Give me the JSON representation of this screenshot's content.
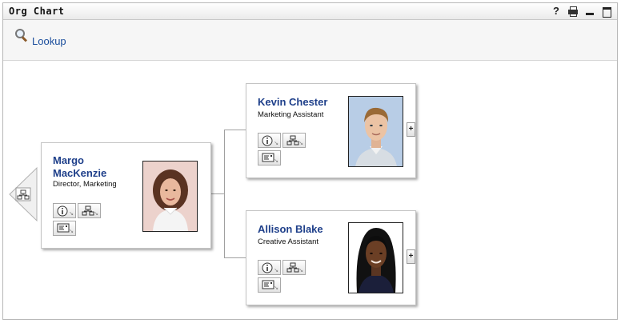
{
  "window": {
    "title": "Org Chart",
    "help_glyph": "?",
    "icons": [
      "help-icon",
      "print-icon",
      "minimize-icon",
      "maximize-icon"
    ]
  },
  "toolbar": {
    "lookup_label": "Lookup",
    "lookup_icon": "search-icon"
  },
  "colors": {
    "name_text": "#1e3f8a",
    "link_text": "#1a4d9c",
    "connector": "#a0a0a0"
  },
  "org": {
    "up_nav_icon": "org-chart-icon",
    "manager": {
      "first_name": "Margo",
      "last_name": "MacKenzie",
      "title": "Director, Marketing",
      "actions": [
        "info-icon",
        "org-chart-icon",
        "email-icon"
      ]
    },
    "reports": [
      {
        "name": "Kevin Chester",
        "title": "Marketing Assistant",
        "expand_label": "+",
        "actions": [
          "info-icon",
          "org-chart-icon",
          "email-icon"
        ]
      },
      {
        "name": "Allison Blake",
        "title": "Creative Assistant",
        "expand_label": "+",
        "actions": [
          "info-icon",
          "org-chart-icon",
          "email-icon"
        ]
      }
    ]
  }
}
